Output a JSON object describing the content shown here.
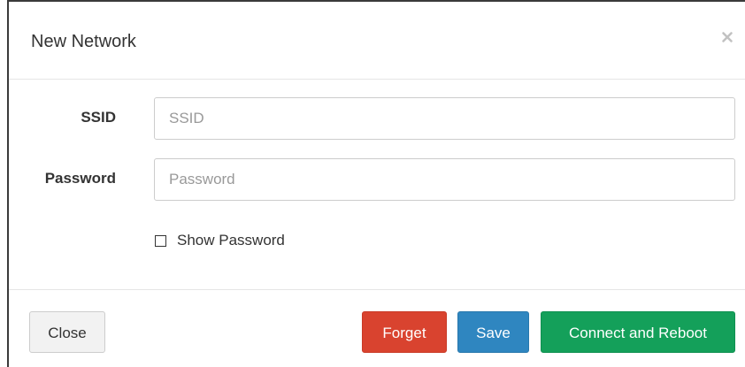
{
  "modal": {
    "title": "New Network",
    "close_icon": "close-x-icon"
  },
  "form": {
    "ssid": {
      "label": "SSID",
      "value": "",
      "placeholder": "SSID"
    },
    "password": {
      "label": "Password",
      "value": "",
      "placeholder": "Password"
    },
    "show_password": {
      "label": "Show Password",
      "checked": false
    }
  },
  "footer": {
    "close_label": "Close",
    "forget_label": "Forget",
    "save_label": "Save",
    "connect_label": "Connect and Reboot"
  },
  "colors": {
    "forget": "#d9432f",
    "save": "#2f86c0",
    "connect": "#14a05a",
    "close_bg": "#f2f2f2"
  }
}
